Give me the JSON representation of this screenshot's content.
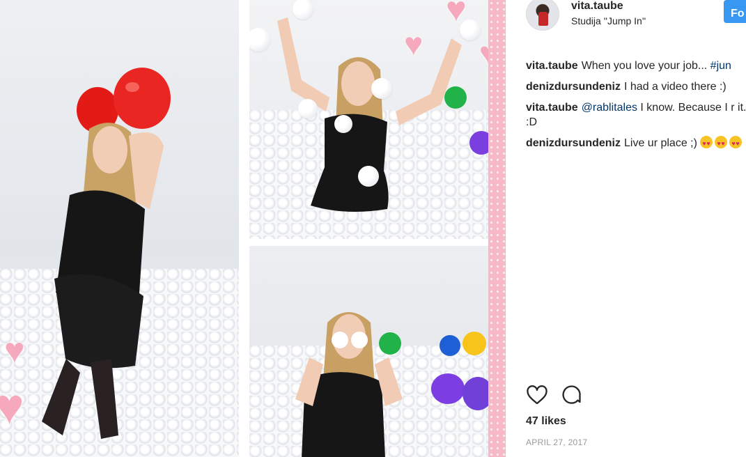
{
  "post": {
    "username": "vita.taube",
    "location": "Studija ''Jump In''",
    "follow_label": "Fo"
  },
  "comments": [
    {
      "user": "vita.taube",
      "text": "When you love your job... ",
      "tag": "#jun"
    },
    {
      "user": "denizdursundeniz",
      "text": "I had a video there :)"
    },
    {
      "user": "vita.taube",
      "mention": "@rablitales",
      "text": " I know. Because I r it. :D"
    },
    {
      "user": "denizdursundeniz",
      "text": "Live ur place ;)",
      "emoji": [
        "heart-eyes-emoji",
        "heart-eyes-emoji",
        "heart-eyes-emoji"
      ]
    }
  ],
  "actions": {
    "like_icon": "heart-outline-icon",
    "comment_icon": "speech-bubble-icon"
  },
  "likes": "47 likes",
  "date": "APRIL 27, 2017",
  "colors": {
    "follow_button": "#3897f0",
    "link": "#003569",
    "muted": "#999999",
    "heart_sticker": "#f6a8bd",
    "pink_strip": "#f7b9c8",
    "balloon_red": "#e8231f"
  }
}
